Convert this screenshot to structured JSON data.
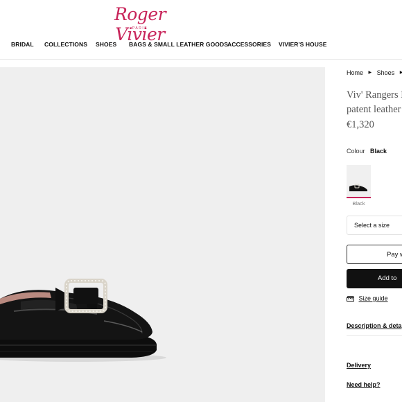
{
  "brand": {
    "name": "Roger Vivier",
    "city": "PARIS",
    "color": "#c8245a"
  },
  "nav": {
    "items": [
      "BRIDAL",
      "COLLECTIONS",
      "SHOES",
      "BAGS & SMALL LEATHER GOODS",
      "ACCESSORIES",
      "VIVIER'S HOUSE"
    ]
  },
  "breadcrumb": {
    "items": [
      "Home",
      "Shoes"
    ],
    "separator_icon": "triangle-right-icon"
  },
  "product": {
    "title_line_1": "Viv' Rangers L",
    "title_line_2": "patent leather",
    "price": "€1,320"
  },
  "colour": {
    "label": "Colour",
    "value": "Black",
    "swatches": [
      {
        "label": "Black",
        "selected": true
      }
    ],
    "accent": "#c8245a"
  },
  "size": {
    "placeholder": "Select a size"
  },
  "actions": {
    "pay_label": "Pay w",
    "add_label": "Add to",
    "size_guide_label": "Size guide",
    "size_guide_icon": "ruler-icon"
  },
  "info_links": {
    "description": "Description & deta",
    "delivery": "Delivery",
    "help": "Need help?"
  }
}
